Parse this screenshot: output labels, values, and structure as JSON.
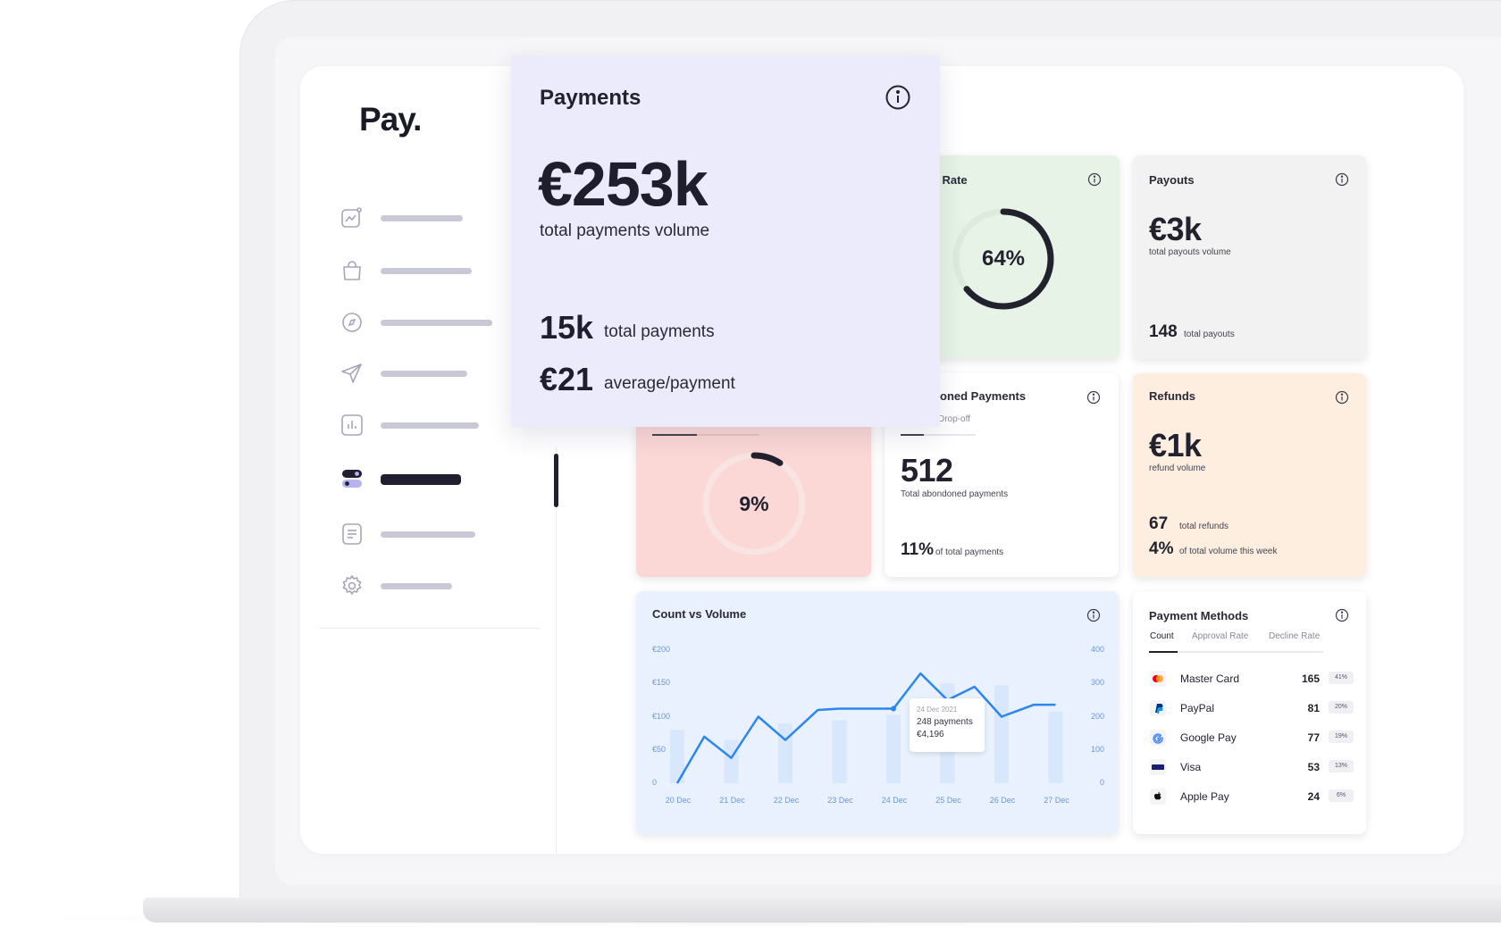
{
  "app": {
    "logo": "Pay."
  },
  "payments": {
    "title": "Payments",
    "volume": "€253k",
    "volume_label": "total payments volume",
    "count": "15k",
    "count_label": "total payments",
    "average": "€21",
    "average_label": "average/payment"
  },
  "approval": {
    "title": "al Rate",
    "percent": "64%",
    "fraction": 0.64
  },
  "payouts": {
    "title": "Payouts",
    "volume": "€3k",
    "volume_label": "total payouts volume",
    "count": "148",
    "count_label": "total payouts"
  },
  "declines": {
    "percent": "9%",
    "fraction": 0.09
  },
  "abandoned": {
    "title": "oned Payments",
    "tab": "Drop-off",
    "count": "512",
    "count_label": "Total abondoned payments",
    "share": "11%",
    "share_label": "of total payments"
  },
  "refunds": {
    "title": "Refunds",
    "volume": "€1k",
    "volume_label": "refund volume",
    "count": "67",
    "count_label": "total refunds",
    "share": "4%",
    "share_label": "of total volume this week"
  },
  "count_vs_volume": {
    "title": "Count vs Volume",
    "tooltip": {
      "date": "24 Dec 2021",
      "payments": "248 payments",
      "amount": "€4,196"
    }
  },
  "chart_data": {
    "type": "line",
    "title": "Count vs Volume",
    "categories": [
      "20 Dec",
      "21 Dec",
      "22 Dec",
      "23 Dec",
      "24 Dec",
      "25 Dec",
      "26 Dec",
      "27 Dec"
    ],
    "y_left_ticks": [
      "0",
      "€50",
      "€100",
      "€150",
      "€200"
    ],
    "y_right_ticks": [
      "0",
      "100",
      "200",
      "300",
      "400"
    ],
    "ylim_left": [
      0,
      200
    ],
    "ylim_right": [
      0,
      400
    ],
    "line": {
      "x": [
        0,
        0.5,
        1,
        1.5,
        2,
        2.6,
        3,
        3.5,
        4,
        4.5,
        5,
        5.5,
        6,
        6.6,
        7
      ],
      "y": [
        0,
        70,
        38,
        100,
        65,
        110,
        112,
        112,
        112,
        165,
        125,
        145,
        100,
        118,
        118
      ]
    },
    "bars": [
      {
        "x": 0,
        "value": 160
      },
      {
        "x": 1,
        "value": 130
      },
      {
        "x": 2,
        "value": 180
      },
      {
        "x": 3,
        "value": 190
      },
      {
        "x": 4,
        "value": 205
      },
      {
        "x": 5,
        "value": 300
      },
      {
        "x": 6,
        "value": 295
      },
      {
        "x": 7,
        "value": 215
      }
    ],
    "colors": {
      "line": "#2b86ee",
      "bars": "#d8e7fb",
      "background": "#e8f1fd"
    }
  },
  "payment_methods": {
    "title": "Payment Methods",
    "tabs": [
      "Count",
      "Approval Rate",
      "Decline Rate"
    ],
    "active_tab": "Count",
    "rows": [
      {
        "name": "Master Card",
        "count": "165",
        "pct": "41%",
        "icon": "mastercard-icon"
      },
      {
        "name": "PayPal",
        "count": "81",
        "pct": "20%",
        "icon": "paypal-icon"
      },
      {
        "name": "Google Pay",
        "count": "77",
        "pct": "19%",
        "icon": "google-pay-icon"
      },
      {
        "name": "Visa",
        "count": "53",
        "pct": "13%",
        "icon": "visa-icon"
      },
      {
        "name": "Apple Pay",
        "count": "24",
        "pct": "6%",
        "icon": "apple-pay-icon"
      }
    ]
  },
  "colors": {
    "accent": "#1f1f30",
    "payments_bg": "#ebebfb",
    "approval_bg": "#e6f3e6",
    "payouts_bg": "#f2f2f2",
    "declines_bg": "#fbd8d6",
    "refunds_bg": "#fdeee0",
    "chart_bg": "#e8f1fd"
  }
}
